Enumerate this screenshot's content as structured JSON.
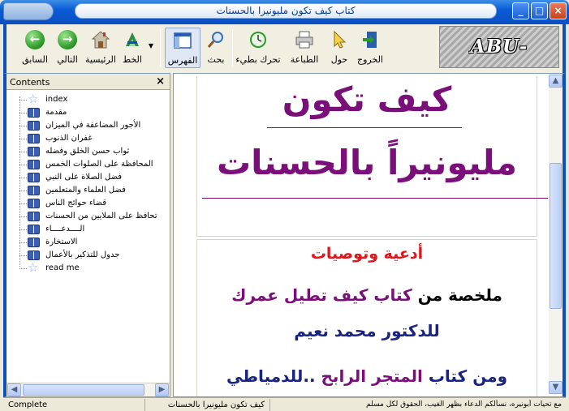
{
  "window": {
    "title": "كتاب كيف تكون مليونيرا بالحسنات"
  },
  "toolbar": {
    "back": "السابق",
    "forward": "التالي",
    "home": "الرئيسية",
    "font": "الخط",
    "index": "الفهرس",
    "search": "بحث",
    "move": "تحرك بطيء",
    "print": "الطباعة",
    "about": "حول",
    "exit": "الخروج",
    "logo": "ABU-NIERA"
  },
  "contents": {
    "title": "Contents",
    "close": "×",
    "items": [
      {
        "label": "index",
        "icon": "star-icon"
      },
      {
        "label": "مقدمة",
        "icon": "book-icon"
      },
      {
        "label": "الأجور المضاعفة في الميزان",
        "icon": "book-icon"
      },
      {
        "label": "غفران الذنوب",
        "icon": "book-icon"
      },
      {
        "label": "ثواب حسن الخلق وفضله",
        "icon": "book-icon"
      },
      {
        "label": "المحافظة على الصلوات الخمس",
        "icon": "book-icon"
      },
      {
        "label": "فضل الصلاة على النبي",
        "icon": "book-icon"
      },
      {
        "label": "فضل العلماء والمتعلمين",
        "icon": "book-icon"
      },
      {
        "label": "قضاء حوائج الناس",
        "icon": "book-icon"
      },
      {
        "label": "تحافظ على الملايين من الحسنات",
        "icon": "book-icon"
      },
      {
        "label": "الــــدعــــاء",
        "icon": "book-icon"
      },
      {
        "label": "الاستخارة",
        "icon": "book-icon"
      },
      {
        "label": "جدول للتذكير بالأعمال",
        "icon": "book-icon"
      },
      {
        "label": "read me",
        "icon": "star-icon"
      }
    ]
  },
  "page": {
    "heading_line1": "كيف تكون",
    "heading_line2": "مليونيراً بالحسنات",
    "subheading": "أدعية وتوصيات",
    "summary_a": "ملخصة من",
    "summary_b": "كتاب كيف تطيل عمرك",
    "author_line": "للدكتور محمد نعيم",
    "from_a": "ومن",
    "from_b": "كتاب",
    "from_c": "المتجر الرابح",
    "from_d": "..للدمياطي"
  },
  "status": {
    "left": "Complete",
    "middle": "كيف تكون مليونيرا بالحسنات",
    "right": "مع تحيات أبونيره، نسألكم الدعاء بظهر الغيب، الحقوق لكل مسلم"
  },
  "colors": {
    "heading": "#7a0f7a",
    "subheading": "#e0161a",
    "navy": "#1a237e",
    "titlebar": "#0b4fc1"
  }
}
